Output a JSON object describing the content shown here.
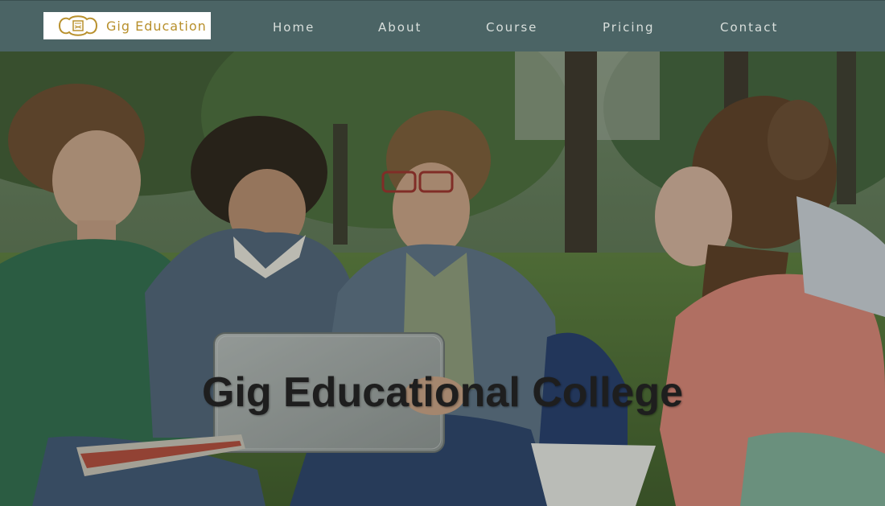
{
  "brand": {
    "name": "Gig Education"
  },
  "nav": {
    "items": [
      {
        "label": "Home"
      },
      {
        "label": "About"
      },
      {
        "label": "Course"
      },
      {
        "label": "Pricing"
      },
      {
        "label": "Contact"
      }
    ]
  },
  "hero": {
    "title": "Gig Educational College",
    "image": "students-studying-outdoors-photo"
  },
  "colors": {
    "navbar": "#4b6465",
    "nav_text": "#d9dfdc",
    "brand_gold": "#b8902c",
    "title_text": "#1e1e1e"
  }
}
